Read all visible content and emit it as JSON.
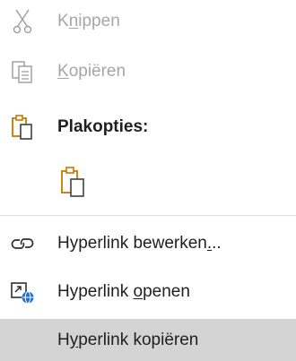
{
  "menu": {
    "cut": {
      "label_a": "K",
      "label_ul": "n",
      "label_b": "ippen",
      "icon": "scissors-icon"
    },
    "copy": {
      "label_a": "",
      "label_ul": "K",
      "label_b": "opiëren",
      "icon": "copy-icon"
    },
    "paste_options": {
      "label": "Plakopties:",
      "icon": "clipboard-icon"
    },
    "paste_keep": {
      "icon": "clipboard-paste-icon"
    },
    "edit_link": {
      "label_a": "Hyperlink bewerken",
      "label_ul": ".",
      "label_b": "..",
      "icon": "link-icon"
    },
    "open_link": {
      "label_a": "Hyperlink ",
      "label_ul": "o",
      "label_b": "penen",
      "icon": "open-link-icon"
    },
    "copy_link": {
      "label_a": "H",
      "label_ul": "y",
      "label_b": "perlink kopiëren"
    }
  },
  "colors": {
    "accent": "#c47a00",
    "disabled": "#a6a6a6",
    "highlight": "#d4d4d4",
    "link_blue": "#1e6fd9"
  }
}
